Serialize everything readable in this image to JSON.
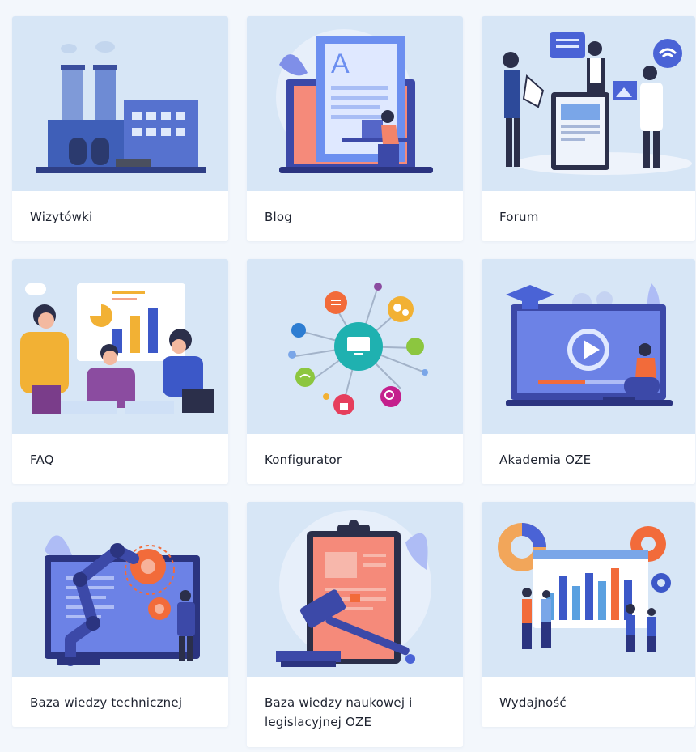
{
  "cards": [
    {
      "label": "Wizytówki",
      "icon": "factory-illustration-icon"
    },
    {
      "label": "Blog",
      "icon": "blog-writer-illustration-icon"
    },
    {
      "label": "Forum",
      "icon": "forum-people-illustration-icon"
    },
    {
      "label": "FAQ",
      "icon": "faq-meeting-illustration-icon"
    },
    {
      "label": "Konfigurator",
      "icon": "configurator-network-illustration-icon"
    },
    {
      "label": "Akademia OZE",
      "icon": "video-course-illustration-icon"
    },
    {
      "label": "Baza wiedzy technicznej",
      "icon": "robot-arm-illustration-icon"
    },
    {
      "label": "Baza wiedzy naukowej i legislacyjnej OZE",
      "icon": "clipboard-gavel-illustration-icon"
    },
    {
      "label": "Wydajność",
      "icon": "performance-charts-illustration-icon"
    }
  ],
  "colors": {
    "page_background": "#f3f7fc",
    "thumbnail_background": "#d7e6f6",
    "label_text": "#1e2330",
    "accent_blue": "#4a63d6",
    "accent_orange": "#f26b3a"
  }
}
